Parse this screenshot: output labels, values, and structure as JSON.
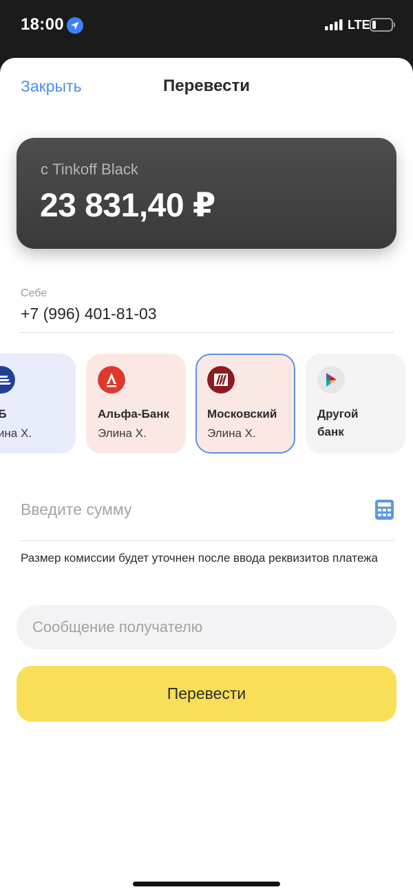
{
  "status_bar": {
    "time": "18:00",
    "network": "LTE",
    "icons": [
      "location-arrow-icon",
      "signal-bars-icon",
      "battery-icon"
    ]
  },
  "header": {
    "close_label": "Закрыть",
    "title": "Перевести"
  },
  "source_card": {
    "label": "с Tinkoff Black",
    "balance": "23 831,40 ₽"
  },
  "recipient": {
    "label": "Себе",
    "phone": "+7 (996) 401-81-03"
  },
  "banks": [
    {
      "name": "ТБ",
      "owner": "лина Х.",
      "logo": "vtb-logo-icon",
      "color": "#1f3f98",
      "bg": "#e8ecfb"
    },
    {
      "name": "Альфа-Банк",
      "owner": "Элина Х.",
      "logo": "alfa-bank-logo-icon",
      "color": "#e0382b",
      "bg": "#fbe8e5"
    },
    {
      "name": "Московский",
      "owner": "Элина Х.",
      "logo": "mkb-logo-icon",
      "color": "#8c1b1f",
      "bg": "#fbe8e5",
      "selected": true
    },
    {
      "name": "Другой",
      "name2": "банк",
      "logo": "sbp-logo-icon",
      "bg": "#f4f4f4"
    }
  ],
  "amount": {
    "placeholder": "Введите сумму",
    "value": "",
    "icon": "calculator-icon"
  },
  "commission_note": "Размер комиссии будет уточнен после ввода реквизитов платежа",
  "message": {
    "placeholder": "Сообщение получателю",
    "value": ""
  },
  "submit_label": "Перевести",
  "colors": {
    "accent_link": "#4a8fe6",
    "submit_bg": "#f9df58",
    "selected_border": "#5b8fe0"
  }
}
